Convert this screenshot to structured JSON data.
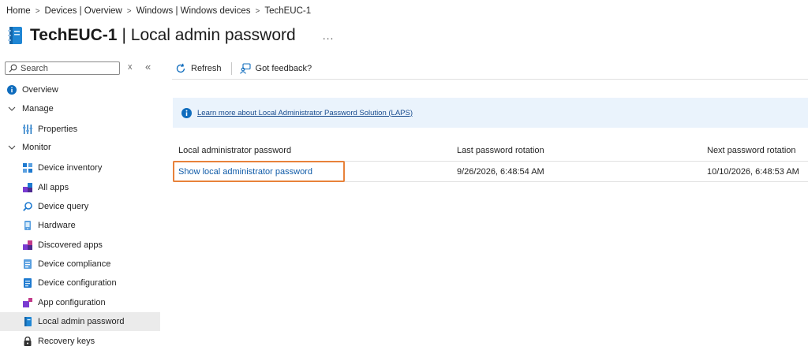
{
  "breadcrumb": {
    "items": [
      "Home",
      "Devices | Overview",
      "Windows | Windows devices",
      "TechEUC-1"
    ]
  },
  "header": {
    "device_name": "TechEUC-1",
    "page_title": "| Local admin password",
    "more": "..."
  },
  "sidebar": {
    "search_placeholder": "Search",
    "close_glyph": "x",
    "collapse_glyph": "«",
    "items": [
      {
        "label": "Overview",
        "icon": "info-icon"
      },
      {
        "label": "Manage",
        "icon": "chevron-down-icon"
      },
      {
        "label": "Properties",
        "icon": "properties-icon"
      },
      {
        "label": "Monitor",
        "icon": "chevron-down-icon"
      },
      {
        "label": "Device inventory",
        "icon": "inventory-icon"
      },
      {
        "label": "All apps",
        "icon": "apps-icon"
      },
      {
        "label": "Device query",
        "icon": "query-icon"
      },
      {
        "label": "Hardware",
        "icon": "hardware-icon"
      },
      {
        "label": "Discovered apps",
        "icon": "apps-icon"
      },
      {
        "label": "Device compliance",
        "icon": "compliance-icon"
      },
      {
        "label": "Device configuration",
        "icon": "configuration-icon"
      },
      {
        "label": "App configuration",
        "icon": "app-configuration-icon"
      },
      {
        "label": "Local admin password",
        "icon": "device-icon"
      },
      {
        "label": "Recovery keys",
        "icon": "lock-icon"
      }
    ]
  },
  "toolbar": {
    "refresh_label": "Refresh",
    "feedback_label": "Got feedback?"
  },
  "banner": {
    "link_text": "Learn more about Local Administrator Password Solution (LAPS)"
  },
  "table": {
    "columns": [
      "Local administrator password",
      "Last password rotation",
      "Next password rotation"
    ],
    "rows": [
      [
        "Show local administrator password",
        "9/26/2026, 6:48:54 AM",
        "10/10/2026, 6:48:53 AM"
      ]
    ]
  },
  "colors": {
    "accent": "#0f6cbd",
    "highlight_border": "#e8823a",
    "banner_bg": "#eaf3fc",
    "active_nav_bg": "#ebebeb"
  }
}
